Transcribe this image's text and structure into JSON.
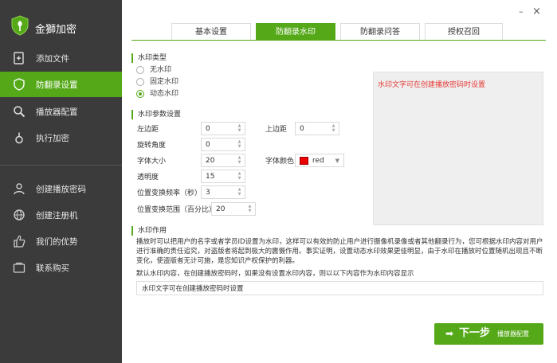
{
  "app": {
    "title": "金獅加密"
  },
  "window": {
    "minimize": "–",
    "close": "×"
  },
  "sidebar": {
    "items": [
      {
        "label": "添加文件",
        "icon": "add-file-icon"
      },
      {
        "label": "防翻录设置",
        "icon": "shield-icon",
        "active": true
      },
      {
        "label": "播放器配置",
        "icon": "search-icon"
      },
      {
        "label": "执行加密",
        "icon": "lock-icon"
      },
      {
        "label": "创建播放密码",
        "icon": "user-icon"
      },
      {
        "label": "创建注册机",
        "icon": "globe-icon"
      },
      {
        "label": "我们的优势",
        "icon": "thumbs-up-icon"
      },
      {
        "label": "联系购买",
        "icon": "contact-icon"
      }
    ]
  },
  "tabs": [
    {
      "label": "基本设置"
    },
    {
      "label": "防翻录水印",
      "active": true
    },
    {
      "label": "防翻录问答"
    },
    {
      "label": "授权召回"
    }
  ],
  "watermark_type": {
    "title": "水印类型",
    "options": [
      "无水印",
      "固定水印",
      "动态水印"
    ],
    "selected": "动态水印"
  },
  "preview": {
    "text": "水印文字可在创建播放密码时设置"
  },
  "params": {
    "title": "水印参数设置",
    "left_margin": {
      "label": "左边距",
      "value": "0"
    },
    "top_margin": {
      "label": "上边距",
      "value": "0"
    },
    "rotation": {
      "label": "旋转角度",
      "value": "0"
    },
    "font_size": {
      "label": "字体大小",
      "value": "20"
    },
    "font_color": {
      "label": "字体颜色",
      "value": "red",
      "swatch": "#ee0000"
    },
    "opacity": {
      "label": "透明度",
      "value": "15"
    },
    "freq": {
      "label": "位置变换频率（秒）",
      "value": "3"
    },
    "range": {
      "label": "位置变换范围（百分比）",
      "value": "20"
    }
  },
  "purpose": {
    "title": "水印作用",
    "description": "播放时可以把用户的名字或者学员ID设置为水印，这样可以有效的防止用户进行摄像机录像或者其他翻录行为，您可根据水印内容对用户进行准确的责任追究，对盗版者将起到极大的震慑作用。事实证明，设置动态水印效果更佳明显，由于水印在播放时位置随机出现且不断变化，使盗版者无计可施，是您知识产权保护的利器。",
    "default_note": "默认水印内容，在创建播放密码时，如果没有设置水印内容，则以以下内容作为水印内容显示",
    "default_value": "水印文字可在创建播放密码时设置"
  },
  "next_button": {
    "label": "下一步",
    "sublabel": "播放器配置",
    "arrow": "➡"
  },
  "colors": {
    "accent": "#55a919",
    "sidebar_bg": "#3b3b3b",
    "preview_text": "#e53935"
  }
}
